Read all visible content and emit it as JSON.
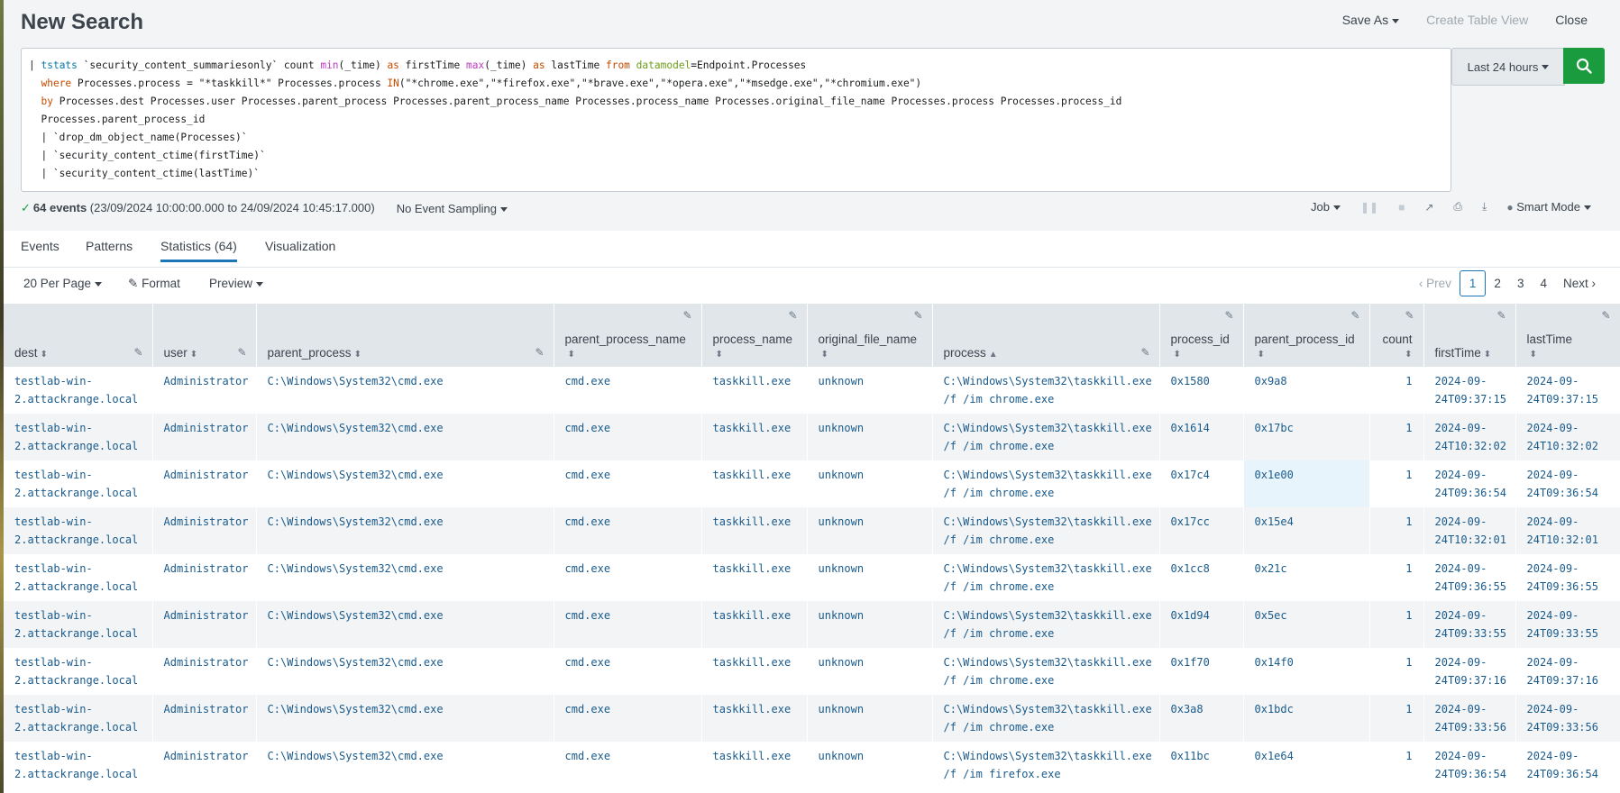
{
  "header": {
    "title": "New Search",
    "save_as": "Save As",
    "create_table_view": "Create Table View",
    "close": "Close"
  },
  "search": {
    "time_range": "Last 24 hours"
  },
  "status": {
    "events_count": "64 events",
    "time_span": "(23/09/2024 10:00:00.000 to 24/09/2024 10:45:17.000)",
    "sampling": "No Event Sampling",
    "job": "Job",
    "mode": "Smart Mode"
  },
  "tabs": [
    {
      "label": "Events"
    },
    {
      "label": "Patterns"
    },
    {
      "label": "Statistics (64)"
    },
    {
      "label": "Visualization"
    }
  ],
  "toolbar": {
    "per_page": "20 Per Page",
    "format": "Format",
    "preview": "Preview"
  },
  "pager": {
    "prev": "Prev",
    "pages": [
      "1",
      "2",
      "3",
      "4"
    ],
    "next": "Next"
  },
  "columns": [
    "dest",
    "user",
    "parent_process",
    "parent_process_name",
    "process_name",
    "original_file_name",
    "process",
    "process_id",
    "parent_process_id",
    "count",
    "firstTime",
    "lastTime"
  ],
  "rows": [
    {
      "dest1": "testlab-win-",
      "dest2": "2.attackrange.local",
      "user": "Administrator",
      "parent_process": "C:\\Windows\\System32\\cmd.exe",
      "parent_process_name": "cmd.exe",
      "process_name": "taskkill.exe",
      "original_file_name": "unknown",
      "process1": "C:\\Windows\\System32\\taskkill.exe",
      "process2": "/f /im chrome.exe",
      "process_id": "0x1580",
      "parent_process_id": "0x9a8",
      "count": "1",
      "first1": "2024-09-",
      "first2": "24T09:37:15",
      "last1": "2024-09-",
      "last2": "24T09:37:15"
    },
    {
      "dest1": "testlab-win-",
      "dest2": "2.attackrange.local",
      "user": "Administrator",
      "parent_process": "C:\\Windows\\System32\\cmd.exe",
      "parent_process_name": "cmd.exe",
      "process_name": "taskkill.exe",
      "original_file_name": "unknown",
      "process1": "C:\\Windows\\System32\\taskkill.exe",
      "process2": "/f /im chrome.exe",
      "process_id": "0x1614",
      "parent_process_id": "0x17bc",
      "count": "1",
      "first1": "2024-09-",
      "first2": "24T10:32:02",
      "last1": "2024-09-",
      "last2": "24T10:32:02"
    },
    {
      "dest1": "testlab-win-",
      "dest2": "2.attackrange.local",
      "user": "Administrator",
      "parent_process": "C:\\Windows\\System32\\cmd.exe",
      "parent_process_name": "cmd.exe",
      "process_name": "taskkill.exe",
      "original_file_name": "unknown",
      "process1": "C:\\Windows\\System32\\taskkill.exe",
      "process2": "/f /im chrome.exe",
      "process_id": "0x17c4",
      "parent_process_id": "0x1e00",
      "count": "1",
      "first1": "2024-09-",
      "first2": "24T09:36:54",
      "last1": "2024-09-",
      "last2": "24T09:36:54"
    },
    {
      "dest1": "testlab-win-",
      "dest2": "2.attackrange.local",
      "user": "Administrator",
      "parent_process": "C:\\Windows\\System32\\cmd.exe",
      "parent_process_name": "cmd.exe",
      "process_name": "taskkill.exe",
      "original_file_name": "unknown",
      "process1": "C:\\Windows\\System32\\taskkill.exe",
      "process2": "/f /im chrome.exe",
      "process_id": "0x17cc",
      "parent_process_id": "0x15e4",
      "count": "1",
      "first1": "2024-09-",
      "first2": "24T10:32:01",
      "last1": "2024-09-",
      "last2": "24T10:32:01"
    },
    {
      "dest1": "testlab-win-",
      "dest2": "2.attackrange.local",
      "user": "Administrator",
      "parent_process": "C:\\Windows\\System32\\cmd.exe",
      "parent_process_name": "cmd.exe",
      "process_name": "taskkill.exe",
      "original_file_name": "unknown",
      "process1": "C:\\Windows\\System32\\taskkill.exe",
      "process2": "/f /im chrome.exe",
      "process_id": "0x1cc8",
      "parent_process_id": "0x21c",
      "count": "1",
      "first1": "2024-09-",
      "first2": "24T09:36:55",
      "last1": "2024-09-",
      "last2": "24T09:36:55"
    },
    {
      "dest1": "testlab-win-",
      "dest2": "2.attackrange.local",
      "user": "Administrator",
      "parent_process": "C:\\Windows\\System32\\cmd.exe",
      "parent_process_name": "cmd.exe",
      "process_name": "taskkill.exe",
      "original_file_name": "unknown",
      "process1": "C:\\Windows\\System32\\taskkill.exe",
      "process2": "/f /im chrome.exe",
      "process_id": "0x1d94",
      "parent_process_id": "0x5ec",
      "count": "1",
      "first1": "2024-09-",
      "first2": "24T09:33:55",
      "last1": "2024-09-",
      "last2": "24T09:33:55"
    },
    {
      "dest1": "testlab-win-",
      "dest2": "2.attackrange.local",
      "user": "Administrator",
      "parent_process": "C:\\Windows\\System32\\cmd.exe",
      "parent_process_name": "cmd.exe",
      "process_name": "taskkill.exe",
      "original_file_name": "unknown",
      "process1": "C:\\Windows\\System32\\taskkill.exe",
      "process2": "/f /im chrome.exe",
      "process_id": "0x1f70",
      "parent_process_id": "0x14f0",
      "count": "1",
      "first1": "2024-09-",
      "first2": "24T09:37:16",
      "last1": "2024-09-",
      "last2": "24T09:37:16"
    },
    {
      "dest1": "testlab-win-",
      "dest2": "2.attackrange.local",
      "user": "Administrator",
      "parent_process": "C:\\Windows\\System32\\cmd.exe",
      "parent_process_name": "cmd.exe",
      "process_name": "taskkill.exe",
      "original_file_name": "unknown",
      "process1": "C:\\Windows\\System32\\taskkill.exe",
      "process2": "/f /im chrome.exe",
      "process_id": "0x3a8",
      "parent_process_id": "0x1bdc",
      "count": "1",
      "first1": "2024-09-",
      "first2": "24T09:33:56",
      "last1": "2024-09-",
      "last2": "24T09:33:56"
    },
    {
      "dest1": "testlab-win-",
      "dest2": "2.attackrange.local",
      "user": "Administrator",
      "parent_process": "C:\\Windows\\System32\\cmd.exe",
      "parent_process_name": "cmd.exe",
      "process_name": "taskkill.exe",
      "original_file_name": "unknown",
      "process1": "C:\\Windows\\System32\\taskkill.exe",
      "process2": "/f /im firefox.exe",
      "process_id": "0x11bc",
      "parent_process_id": "0x1e64",
      "count": "1",
      "first1": "2024-09-",
      "first2": "24T09:36:54",
      "last1": "2024-09-",
      "last2": "24T09:36:54"
    }
  ],
  "icons": {
    "search": "magnifier-icon",
    "edit": "pencil-icon",
    "sort": "sort-icon"
  },
  "colors": {
    "accent": "#1a76b6",
    "search_button": "#1a9c3e",
    "cell_text": "#1a5b8c"
  }
}
